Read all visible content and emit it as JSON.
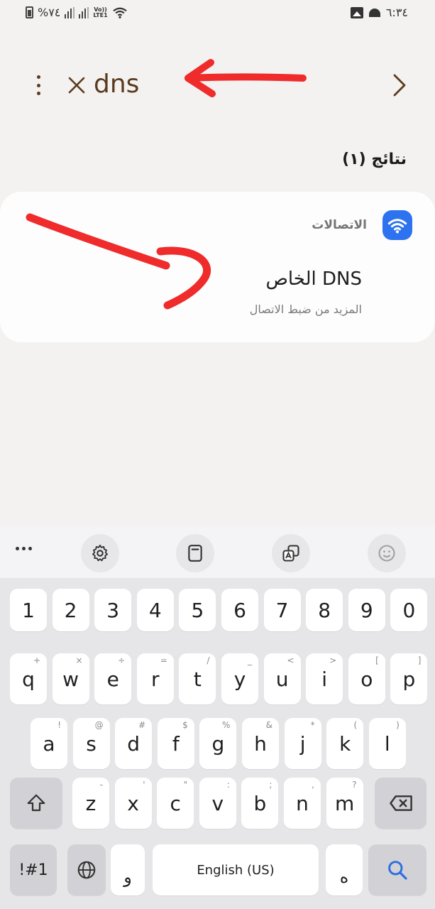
{
  "status_bar": {
    "battery_text": "%٧٤",
    "network": "LTE1",
    "volte": "Vo))",
    "time": "٦:٣٤"
  },
  "search": {
    "query": "dns",
    "icons": {
      "more": "more-vert-icon",
      "clear": "close-icon",
      "back": "chevron-right-icon"
    }
  },
  "results": {
    "title": "نتائج (١)",
    "items": [
      {
        "category": "الاتصالات",
        "category_icon": "wifi-icon",
        "category_icon_color": "#2d73f0",
        "title": "DNS الخاص",
        "subtitle": "المزيد من ضبط الاتصال"
      }
    ]
  },
  "annotation_color": "#ef2b2b",
  "keyboard": {
    "toolbar": [
      "more-horiz-icon",
      "settings-icon",
      "clipboard-icon",
      "translate-icon",
      "emoji-icon"
    ],
    "number_row": [
      "1",
      "2",
      "3",
      "4",
      "5",
      "6",
      "7",
      "8",
      "9",
      "0"
    ],
    "row1": [
      {
        "key": "q",
        "hint": "+"
      },
      {
        "key": "w",
        "hint": "×"
      },
      {
        "key": "e",
        "hint": "÷"
      },
      {
        "key": "r",
        "hint": "="
      },
      {
        "key": "t",
        "hint": "/"
      },
      {
        "key": "y",
        "hint": "_"
      },
      {
        "key": "u",
        "hint": "<"
      },
      {
        "key": "i",
        "hint": ">"
      },
      {
        "key": "o",
        "hint": "["
      },
      {
        "key": "p",
        "hint": "]"
      }
    ],
    "row2": [
      {
        "key": "a",
        "hint": "!"
      },
      {
        "key": "s",
        "hint": "@"
      },
      {
        "key": "d",
        "hint": "#"
      },
      {
        "key": "f",
        "hint": "$"
      },
      {
        "key": "g",
        "hint": "%"
      },
      {
        "key": "h",
        "hint": "&"
      },
      {
        "key": "j",
        "hint": "*"
      },
      {
        "key": "k",
        "hint": "("
      },
      {
        "key": "l",
        "hint": ")"
      }
    ],
    "row3": [
      {
        "key": "z",
        "hint": "-"
      },
      {
        "key": "x",
        "hint": "'"
      },
      {
        "key": "c",
        "hint": "\""
      },
      {
        "key": "v",
        "hint": ":"
      },
      {
        "key": "b",
        "hint": ";"
      },
      {
        "key": "n",
        "hint": ","
      },
      {
        "key": "m",
        "hint": "?"
      }
    ],
    "symbols_label": "!#1",
    "space_label": "English (US)",
    "arabic_left": "و",
    "arabic_right": "ه"
  }
}
